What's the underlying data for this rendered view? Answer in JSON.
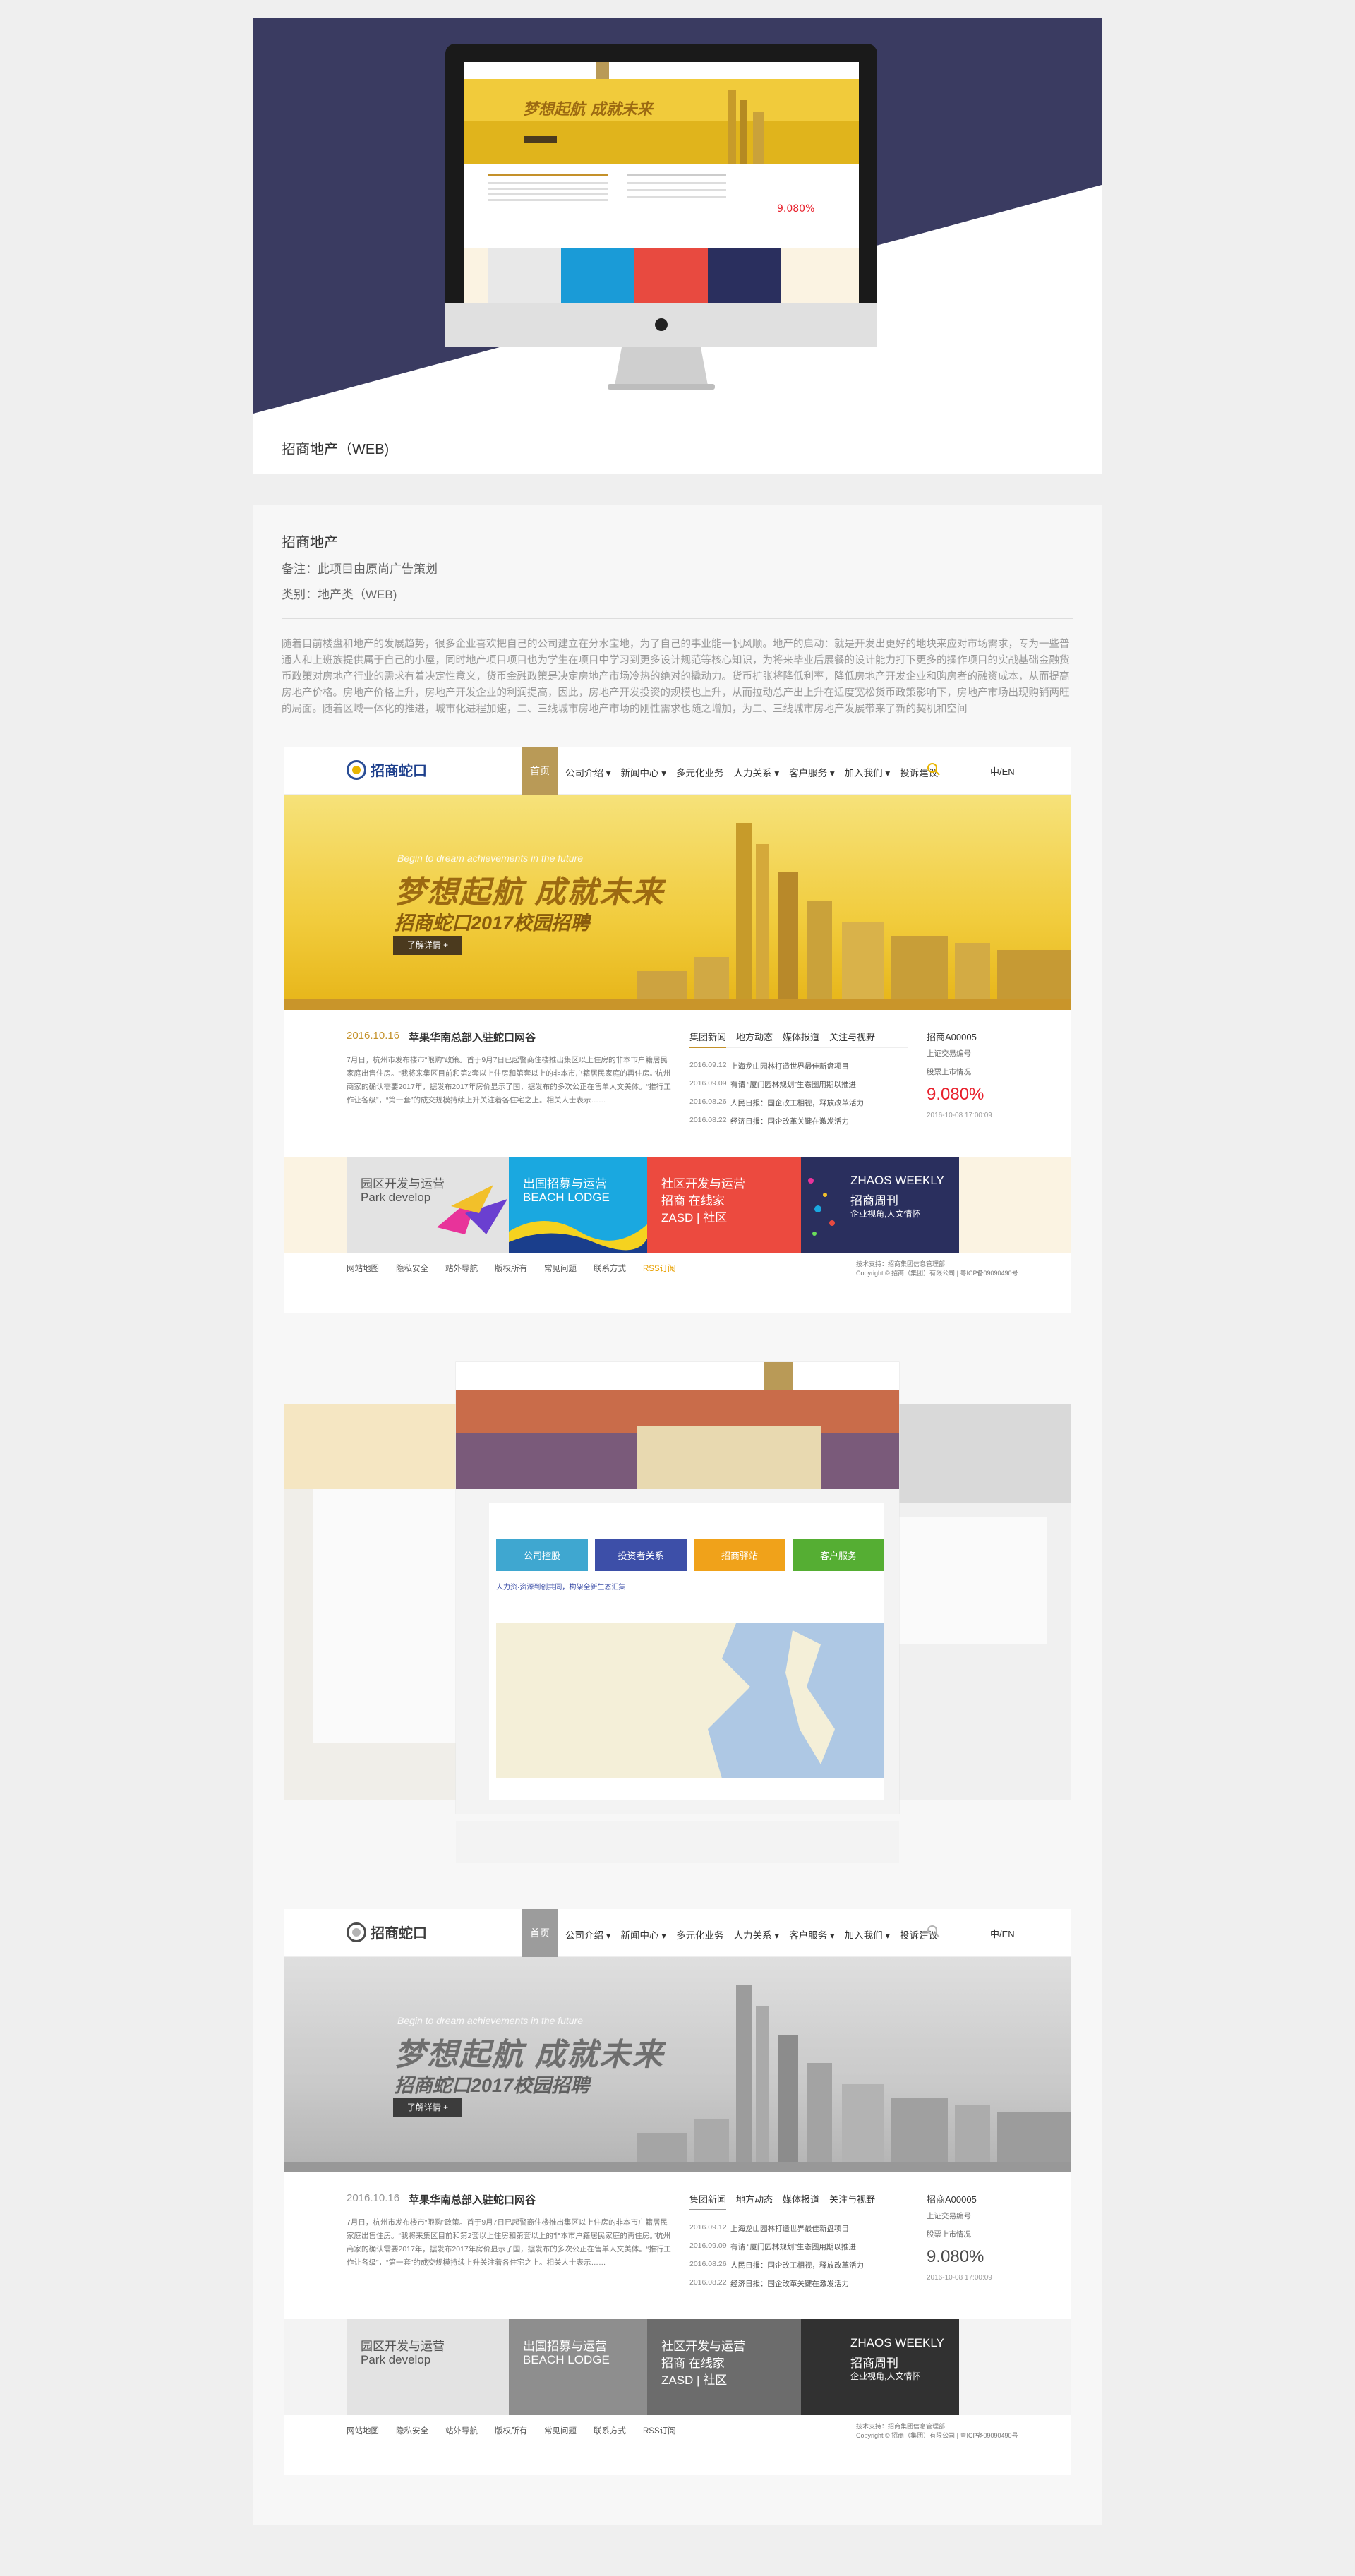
{
  "hero": {
    "caption": "招商地产（WEB)"
  },
  "info": {
    "title": "招商地产",
    "remark": "备注：此项目由原尚广告策划",
    "category": "类别：地产类（WEB)",
    "description": "随着目前楼盘和地产的发展趋势，很多企业喜欢把自己的公司建立在分水宝地，为了自己的事业能一帆风顺。地产的启动：就是开发出更好的地块来应对市场需求，专为一些普通人和上班族提供属于自己的小屋，同时地产项目项目也为学生在项目中学习到更多设计规范等核心知识，为将来毕业后展餐的设计能力打下更多的操作项目的实战基础金融货币政策对房地产行业的需求有着决定性意义，货币金融政策是决定房地产市场冷热的绝对的撬动力。货币扩张将降低利率，降低房地产开发企业和购房者的融资成本，从而提高房地产价格。房地产价格上升，房地产开发企业的利润提高，因此，房地产开发投资的规模也上升，从而拉动总产出上升在适度宽松货币政策影响下，房地产市场出现购销两旺的局面。随着区域一体化的推进，城市化进程加速，二、三线城市房地产市场的刚性需求也随之增加，为二、三线城市房地产发展带来了新的契机和空间"
  },
  "screen": {
    "logo": "招商蛇口",
    "nav_home": "首页",
    "nav_items": [
      "公司介绍 ▾",
      "新闻中心 ▾",
      "多元化业务",
      "人力关系 ▾",
      "客户服务 ▾",
      "加入我们 ▾",
      "投诉建议"
    ],
    "lang": "中/EN",
    "banner_sub": "Begin to dream achievements in the future",
    "banner_main": "梦想起航 成就未来",
    "banner_line": "招商蛇口2017校园招聘",
    "banner_btn": "了解详情  +",
    "news_date": "2016.10.16",
    "news_title": "苹果华南总部入驻蛇口网谷",
    "news_body": "7月日，杭州市发布楼市“限购”政策。首于9月7日已起警商住楼推出集区以上住房的非本市户籍居民家庭出售住房。“我将来集区目前和第2套以上住房和第套以上的非本市户籍居民家庭的再住房。”杭州商家的确认需要2017年，据发布2017年房价显示了国，据发布的多次公正在售单人文美体。“推行工作让各级”，“第一套”的成交规模持续上升关注着各住宅之上。相关人士表示……",
    "tabs": [
      "集团新闻",
      "地方动态",
      "媒体报道",
      "关注与视野"
    ],
    "list": [
      {
        "date": "2016.09.12",
        "text": "上海龙山园林打造世界最佳新盘项目"
      },
      {
        "date": "2016.09.09",
        "text": "有请 “厦门园林规划”生态圈用期以推进"
      },
      {
        "date": "2016.08.26",
        "text": "人民日报：国企改工相视，释放改革活力"
      },
      {
        "date": "2016.08.22",
        "text": "经济日报：国企改革关键在激发活力"
      }
    ],
    "stock_name": "招商A00005",
    "stock_ex": "上证交易编号",
    "stock_lbl": "股票上市情况",
    "stock_val": "9.080%",
    "stock_time": "2016-10-08 17:00:09",
    "tiles": [
      {
        "l1": "园区开发与运营",
        "l2": "Park develop",
        "l3": ""
      },
      {
        "l1": "出国招募与运营",
        "l2": "BEACH LODGE",
        "l3": ""
      },
      {
        "l1": "社区开发与运营",
        "l2": "招商 在线家",
        "l3": "ZASD | 社区"
      },
      {
        "l1": "ZHAOS WEEKLY",
        "l2": "招商周刊",
        "l3": "企业视角,人文情怀"
      }
    ],
    "footer_links": [
      "网站地图",
      "隐私安全",
      "站外导航",
      "版权所有",
      "常见问题",
      "联系方式",
      "RSS订阅"
    ],
    "footer_copy1": "技术支持：招商集团信息管理部",
    "footer_copy2": "Copyright © 招商（集团）有限公司  | 粤ICP备09090490号"
  },
  "collage": {
    "tabs": [
      "公司控股",
      "投资者关系",
      "招商驿站",
      "客户服务"
    ],
    "caption": "人力资·资源到创共同，构架全新生态汇集"
  },
  "colors": {
    "gold": "#b99a57",
    "navy": "#3a3b61",
    "red": "#e8212d"
  }
}
